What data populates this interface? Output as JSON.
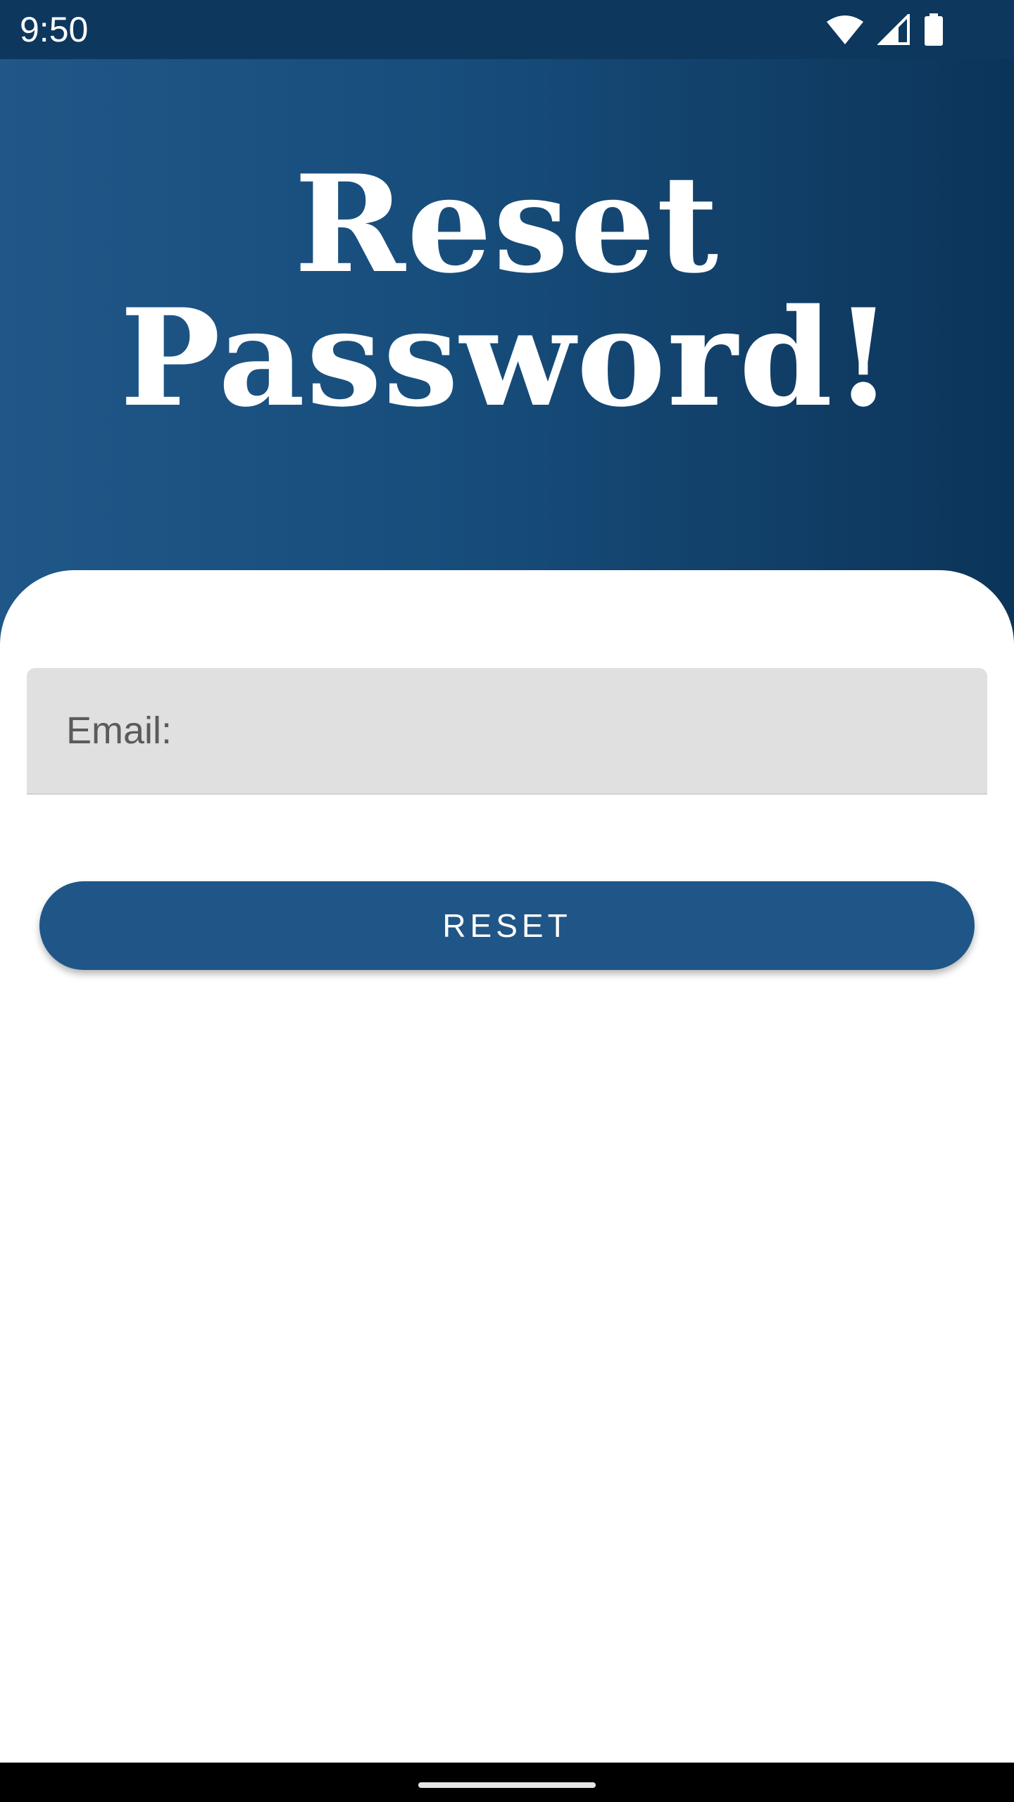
{
  "status_bar": {
    "time": "9:50",
    "icons": [
      "wifi-icon",
      "signal-icon",
      "battery-icon"
    ]
  },
  "header": {
    "title_line1": "Reset",
    "title_line2": "Password!"
  },
  "form": {
    "email_placeholder": "Email:",
    "email_value": "",
    "reset_label": "RESET"
  },
  "colors": {
    "header_gradient_start": "#1f5788",
    "header_gradient_end": "#0c3459",
    "status_bar": "#0d375d",
    "button": "#1f5687",
    "input_bg": "#e0e0e0"
  }
}
